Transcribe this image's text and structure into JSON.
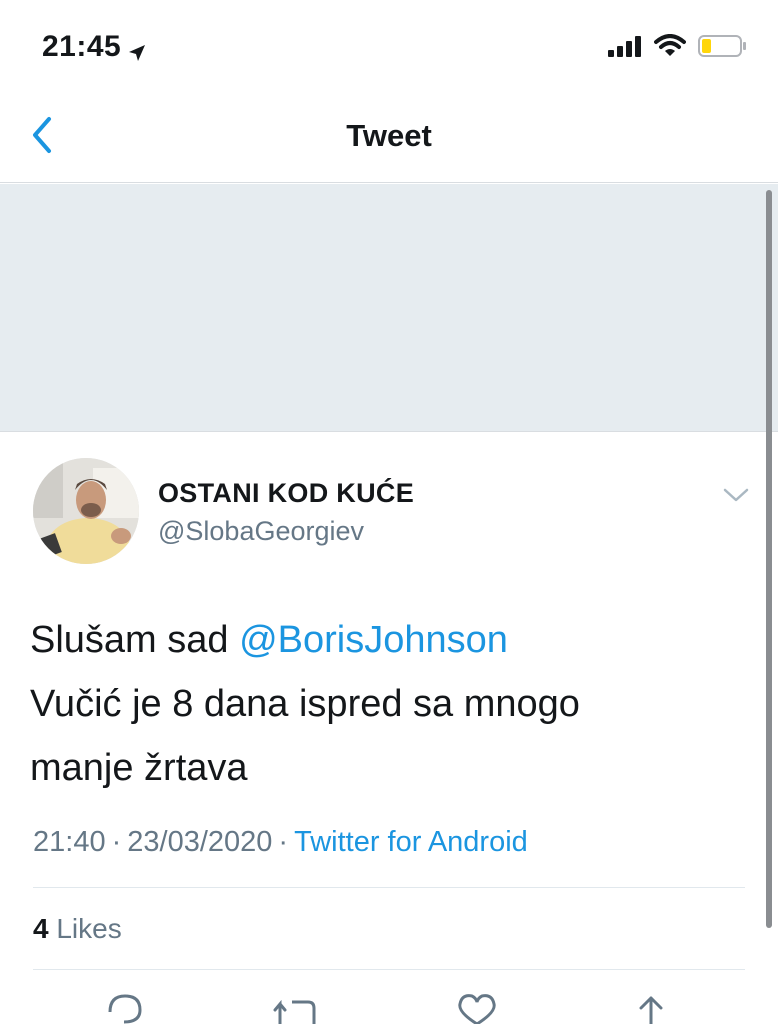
{
  "status_bar": {
    "time": "21:45",
    "location_icon": "location-arrow-icon",
    "signal_icon": "cellular-signal-icon",
    "wifi_icon": "wifi-icon",
    "battery_icon": "battery-low-icon",
    "battery_color": "#ffd60a"
  },
  "nav": {
    "back_icon": "chevron-left-icon",
    "title": "Tweet"
  },
  "tweet": {
    "display_name": "OSTANI KOD KUĆE",
    "handle": "@SlobaGeorgiev",
    "text_before": "Slušam sad ",
    "mention": "@BorisJohnson",
    "text_line2": "Vučić je 8 dana ispred sa mnogo",
    "text_line3": "manje žrtava",
    "time": "21:40",
    "date": "23/03/2020",
    "separator": "·",
    "source": "Twitter for Android",
    "likes_count": "4",
    "likes_label": "Likes"
  },
  "actions": {
    "reply_icon": "reply-icon",
    "retweet_icon": "retweet-icon",
    "like_icon": "heart-icon",
    "share_icon": "share-icon"
  },
  "colors": {
    "accent": "#1b95e0",
    "grey_area": "#e6ecf0",
    "secondary_text": "#657786"
  }
}
